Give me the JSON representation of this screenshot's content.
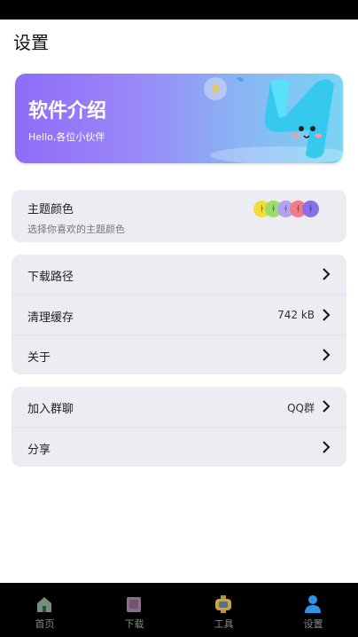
{
  "page": {
    "title": "设置"
  },
  "banner": {
    "title": "软件介绍",
    "subtitle": "Hello,各位小伙伴"
  },
  "theme": {
    "title": "主题颜色",
    "subtitle": "选择你喜欢的主题颜色",
    "swatch_colors": [
      "#f2de3a",
      "#9bdd6a",
      "#b3a1f1",
      "#ef7b86",
      "#8a70e6"
    ]
  },
  "settings_group_1": [
    {
      "label": "下载路径",
      "value": ""
    },
    {
      "label": "清理缓存",
      "value": "742 kB"
    },
    {
      "label": "关于",
      "value": ""
    }
  ],
  "settings_group_2": [
    {
      "label": "加入群聊",
      "value": "QQ群"
    },
    {
      "label": "分享",
      "value": ""
    }
  ],
  "tabbar": {
    "items": [
      {
        "label": "首页",
        "icon": "home-icon"
      },
      {
        "label": "下载",
        "icon": "download-icon"
      },
      {
        "label": "工具",
        "icon": "tools-icon"
      },
      {
        "label": "设置",
        "icon": "user-icon"
      }
    ],
    "active_index": 3
  },
  "colors": {
    "accent": "#2f93e8",
    "card_bg": "#ececf3"
  }
}
